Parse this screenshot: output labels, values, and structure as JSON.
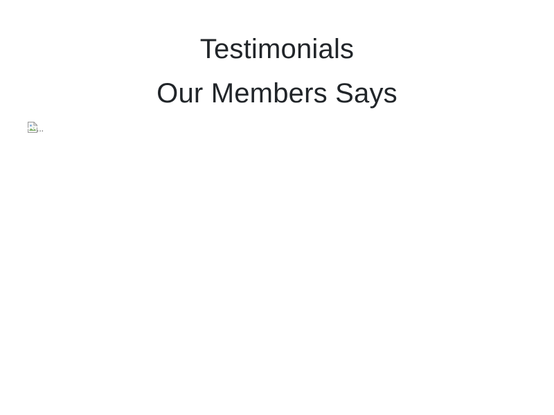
{
  "testimonials": {
    "title": "Testimonials",
    "subtitle": "Our Members Says",
    "image": {
      "alt": "...",
      "icon": "broken-image-icon"
    }
  },
  "colors": {
    "background": "#ffffff",
    "text": "#212529"
  }
}
